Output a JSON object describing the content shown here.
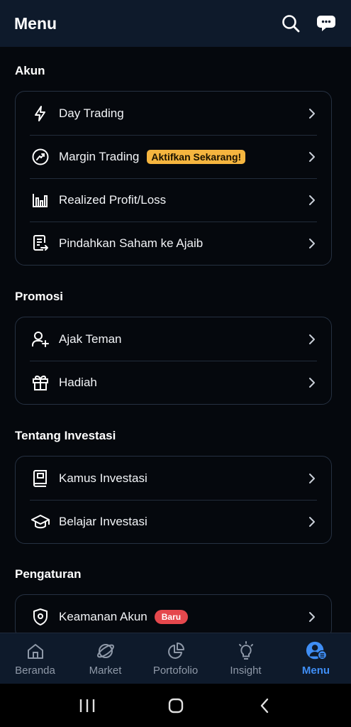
{
  "header": {
    "title": "Menu",
    "search_icon": "search-icon",
    "chat_icon": "chat-support-icon"
  },
  "sections": {
    "akun": {
      "title": "Akun",
      "items": [
        {
          "label": "Day Trading",
          "icon": "lightning-icon"
        },
        {
          "label": "Margin Trading",
          "icon": "margin-trading-icon",
          "badge": "Aktifkan Sekarang!"
        },
        {
          "label": "Realized Profit/Loss",
          "icon": "chart-icon"
        },
        {
          "label": "Pindahkan Saham ke Ajaib",
          "icon": "transfer-document-icon"
        }
      ]
    },
    "promosi": {
      "title": "Promosi",
      "items": [
        {
          "label": "Ajak Teman",
          "icon": "add-user-icon"
        },
        {
          "label": "Hadiah",
          "icon": "gift-icon"
        }
      ]
    },
    "tentang": {
      "title": "Tentang Investasi",
      "items": [
        {
          "label": "Kamus Investasi",
          "icon": "book-icon"
        },
        {
          "label": "Belajar Investasi",
          "icon": "graduation-cap-icon"
        }
      ]
    },
    "pengaturan": {
      "title": "Pengaturan",
      "items": [
        {
          "label": "Keamanan Akun",
          "icon": "shield-icon",
          "badge": "Baru"
        }
      ]
    }
  },
  "bottom_nav": {
    "items": [
      {
        "label": "Beranda",
        "icon": "home-icon"
      },
      {
        "label": "Market",
        "icon": "market-icon"
      },
      {
        "label": "Portofolio",
        "icon": "pie-chart-icon"
      },
      {
        "label": "Insight",
        "icon": "lightbulb-icon"
      },
      {
        "label": "Menu",
        "icon": "profile-icon",
        "active": true
      }
    ]
  },
  "colors": {
    "header_bg": "#0e1a2b",
    "background": "#05080d",
    "accent": "#3f8ef5",
    "badge_yellow": "#f5b53f",
    "badge_red": "#e5484d"
  }
}
